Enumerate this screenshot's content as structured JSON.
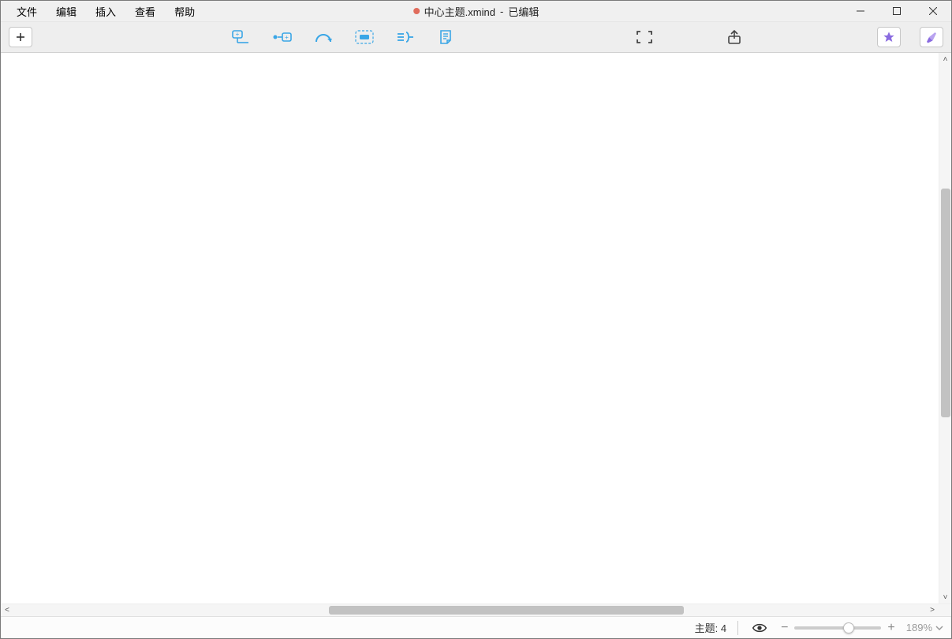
{
  "menubar": {
    "items": [
      "文件",
      "编辑",
      "插入",
      "查看",
      "帮助"
    ]
  },
  "title": {
    "filename": "中心主题.xmind",
    "status": "已编辑",
    "separator": " - "
  },
  "window_controls": {
    "minimize": "minimize",
    "maximize": "maximize",
    "close": "close"
  },
  "toolbar": {
    "new_tab": "new-tab",
    "subtopic": "subtopic",
    "floating_topic": "floating-topic",
    "relationship": "relationship",
    "boundary": "boundary",
    "summary": "summary",
    "note": "note",
    "fitmap": "fit-map",
    "share": "share",
    "upgrade": "upgrade",
    "format": "format"
  },
  "statusbar": {
    "topic_label": "主题",
    "topic_count": "4",
    "zoom_percent": "189%"
  },
  "colors": {
    "toolbar_blue": "#3aa6e6",
    "accent_purple": "#8a6be0"
  }
}
